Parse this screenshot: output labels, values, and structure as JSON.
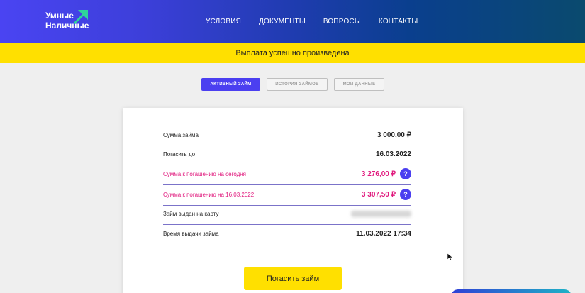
{
  "header": {
    "logo_line1": "Умные",
    "logo_line2": "Наличные",
    "nav": [
      "УСЛОВИЯ",
      "ДОКУМЕНТЫ",
      "ВОПРОСЫ",
      "КОНТАКТЫ"
    ]
  },
  "banner": {
    "text": "Выплата успешно произведена"
  },
  "tabs": [
    "АКТИВНЫЙ ЗАЙМ",
    "ИСТОРИЯ ЗАЙМОВ",
    "МОИ ДАННЫЕ"
  ],
  "loan": {
    "rows": [
      {
        "label": "Сумма займа",
        "value": "3 000,00 ₽"
      },
      {
        "label": "Погасить до",
        "value": "16.03.2022"
      },
      {
        "label": "Сумма к погашению на сегодня",
        "value": "3 276,00 ₽",
        "help": "?"
      },
      {
        "label": "Сумма к погашению на 16.03.2022",
        "value": "3 307,50 ₽",
        "help": "?"
      },
      {
        "label": "Займ выдан на карту",
        "value": ""
      },
      {
        "label": "Время выдачи займа",
        "value": "11.03.2022 17:34"
      }
    ]
  },
  "actions": {
    "pay_label": "Погасить займ"
  },
  "colors": {
    "accent": "#4b3ff0",
    "yellow": "#ffe000",
    "pink": "#e0197d"
  }
}
